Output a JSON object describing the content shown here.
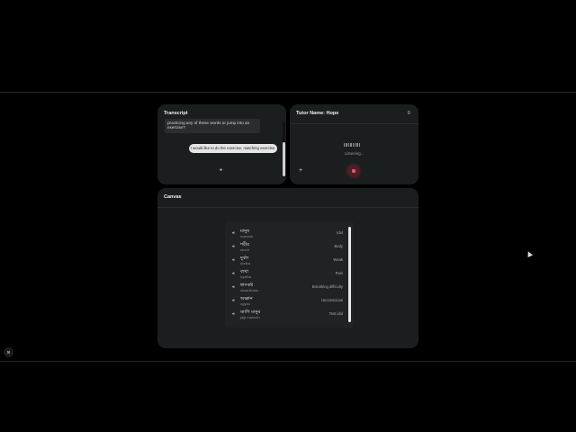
{
  "transcript": {
    "title": "Transcript",
    "ai_message": "practicing any of these words or jump into an exercise?",
    "user_message": "I would like to do the exercise, matching exercise."
  },
  "tutor": {
    "title": "Tutor Name: Hope",
    "status": "Listening..."
  },
  "canvas": {
    "title": "Canvas",
    "words": [
      {
        "word": "মানুষ",
        "translit": "manush",
        "meaning": "Idol"
      },
      {
        "word": "শরীর",
        "translit": "shorir",
        "meaning": "Body"
      },
      {
        "word": "দুর্বল",
        "translit": "durbol",
        "meaning": "Weak"
      },
      {
        "word": "ব্যথা",
        "translit": "byatha",
        "meaning": "Pain"
      },
      {
        "word": "শ্বাসকষ্ট",
        "translit": "shashkosto",
        "meaning": "Breathing difficulty"
      },
      {
        "word": "অজ্ঞান",
        "translit": "ogyan",
        "meaning": "Unconscious"
      },
      {
        "word": "জাগি মানুষ",
        "translit": "jagi manush",
        "meaning": "Test idol"
      }
    ]
  },
  "icons": {
    "speaker": "🔊︎",
    "plus": "+",
    "mic": "0",
    "keyboard": "⌘"
  }
}
